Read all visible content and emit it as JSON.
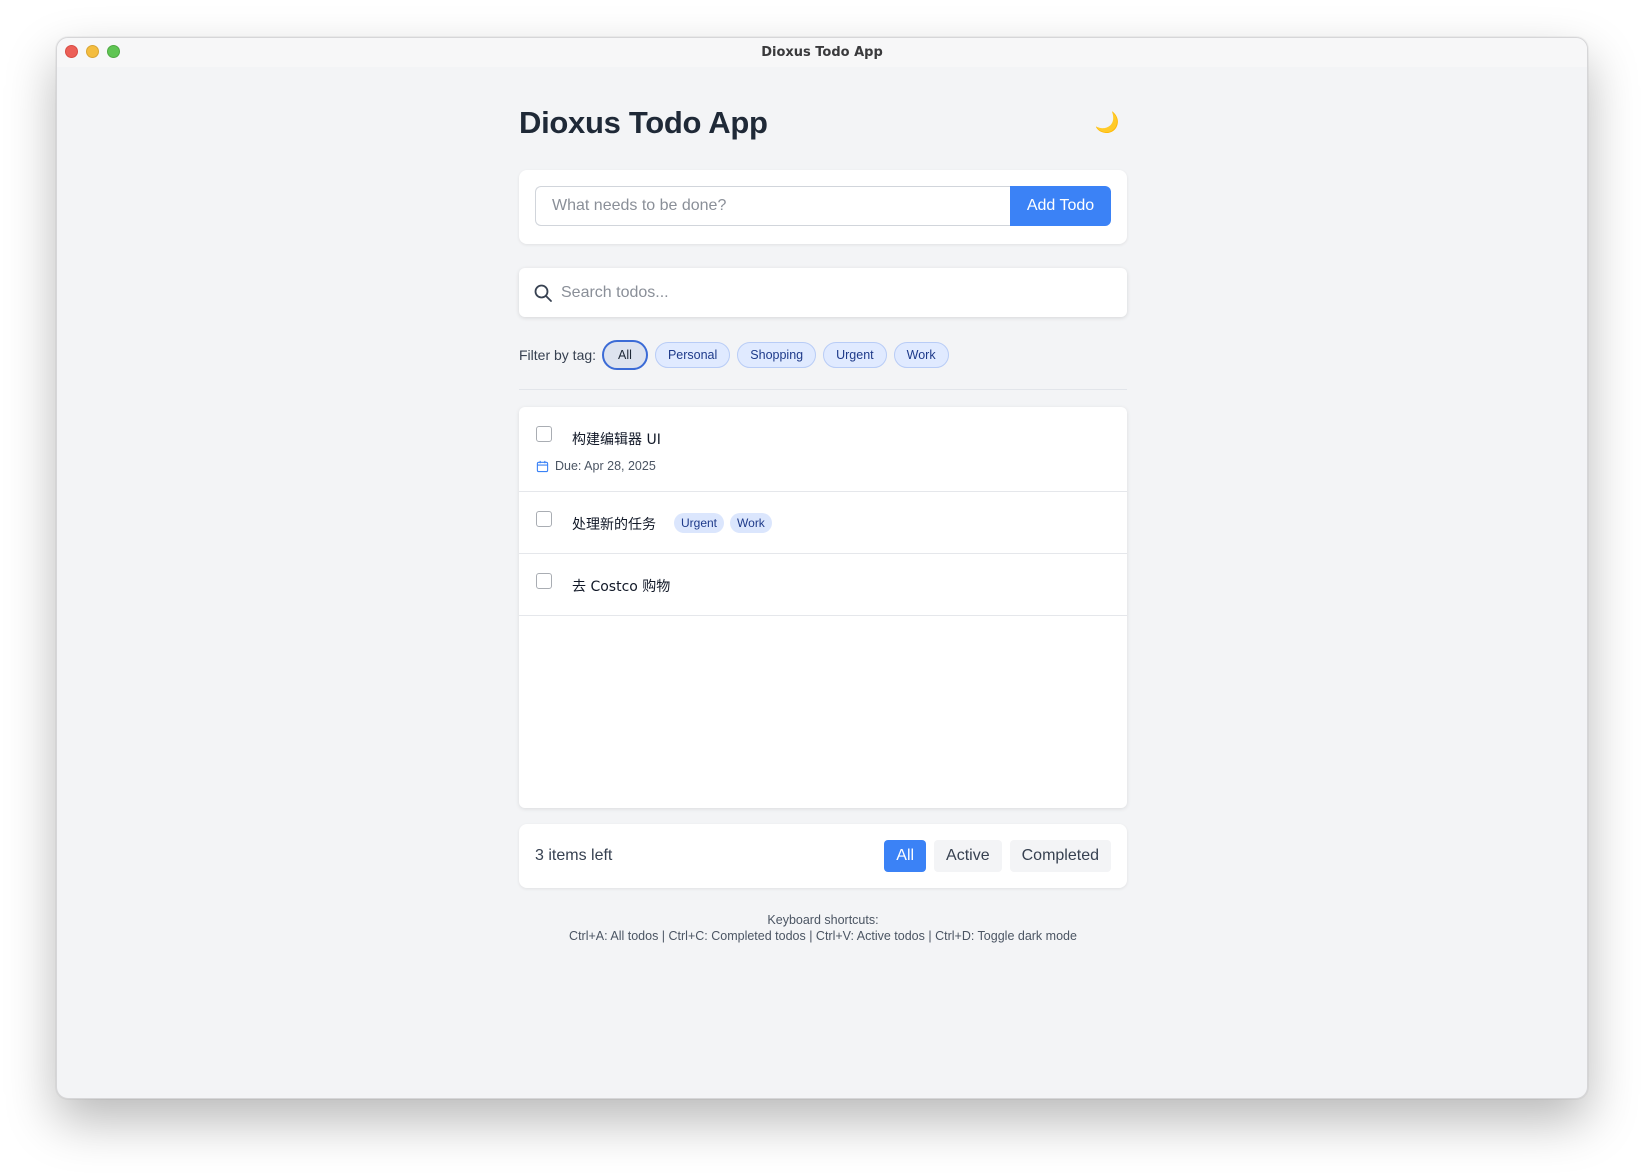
{
  "window": {
    "title": "Dioxus Todo App"
  },
  "header": {
    "title": "Dioxus Todo App",
    "theme_toggle_icon": "🌙"
  },
  "add_todo": {
    "placeholder": "What needs to be done?",
    "button_label": "Add Todo"
  },
  "search": {
    "placeholder": "Search todos..."
  },
  "tag_filter": {
    "label": "Filter by tag:",
    "tags": [
      "All",
      "Personal",
      "Shopping",
      "Urgent",
      "Work"
    ],
    "selected": "All"
  },
  "todos": [
    {
      "text": "构建编辑器 UI",
      "due": "Due: Apr 28, 2025",
      "tags": [],
      "completed": false
    },
    {
      "text": "处理新的任务",
      "due": "",
      "tags": [
        "Urgent",
        "Work"
      ],
      "completed": false
    },
    {
      "text": "去 Costco 购物",
      "due": "",
      "tags": [],
      "completed": false
    }
  ],
  "footer": {
    "items_left": "3 items left",
    "filters": [
      "All",
      "Active",
      "Completed"
    ],
    "active_filter": "All"
  },
  "shortcuts": {
    "title": "Keyboard shortcuts:",
    "text": "Ctrl+A: All todos | Ctrl+C: Completed todos | Ctrl+V: Active todos | Ctrl+D: Toggle dark mode"
  },
  "colors": {
    "accent": "#3b82f6",
    "background": "#f3f4f6",
    "tag_bg": "#dbe6fd"
  }
}
